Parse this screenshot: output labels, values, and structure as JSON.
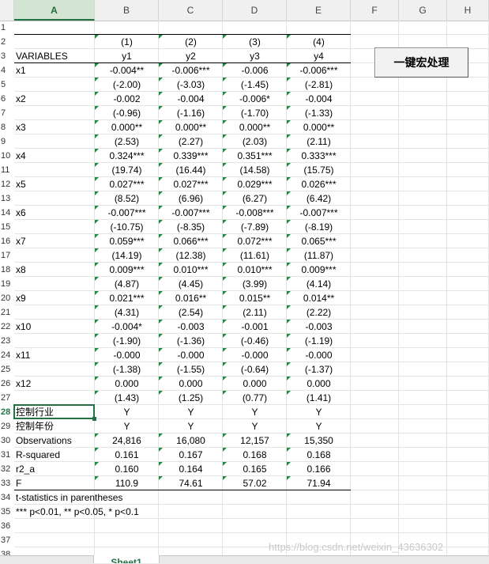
{
  "columns": [
    "A",
    "B",
    "C",
    "D",
    "E",
    "F",
    "G",
    "H"
  ],
  "rows": [
    "1",
    "2",
    "3",
    "4",
    "5",
    "6",
    "7",
    "8",
    "9",
    "10",
    "11",
    "12",
    "13",
    "14",
    "15",
    "16",
    "17",
    "18",
    "19",
    "20",
    "21",
    "22",
    "23",
    "24",
    "25",
    "26",
    "27",
    "28",
    "29",
    "30",
    "31",
    "32",
    "33",
    "34",
    "35",
    "36",
    "37",
    "38"
  ],
  "selected_column": "A",
  "selected_row": "28",
  "cells": [
    {
      "r": 2,
      "c": "B",
      "v": "(1)",
      "tri": true
    },
    {
      "r": 2,
      "c": "C",
      "v": "(2)",
      "tri": true
    },
    {
      "r": 2,
      "c": "D",
      "v": "(3)",
      "tri": true
    },
    {
      "r": 2,
      "c": "E",
      "v": "(4)",
      "tri": true
    },
    {
      "r": 3,
      "c": "A",
      "v": "VARIABLES"
    },
    {
      "r": 3,
      "c": "B",
      "v": "y1"
    },
    {
      "r": 3,
      "c": "C",
      "v": "y2"
    },
    {
      "r": 3,
      "c": "D",
      "v": "y3"
    },
    {
      "r": 3,
      "c": "E",
      "v": "y4"
    },
    {
      "r": 4,
      "c": "A",
      "v": "x1"
    },
    {
      "r": 4,
      "c": "B",
      "v": "-0.004**",
      "tri": true
    },
    {
      "r": 4,
      "c": "C",
      "v": "-0.006***",
      "tri": true
    },
    {
      "r": 4,
      "c": "D",
      "v": "-0.006",
      "tri": true
    },
    {
      "r": 4,
      "c": "E",
      "v": "-0.006***",
      "tri": true
    },
    {
      "r": 5,
      "c": "B",
      "v": "(-2.00)",
      "tri": true
    },
    {
      "r": 5,
      "c": "C",
      "v": "(-3.03)",
      "tri": true
    },
    {
      "r": 5,
      "c": "D",
      "v": "(-1.45)",
      "tri": true
    },
    {
      "r": 5,
      "c": "E",
      "v": "(-2.81)",
      "tri": true
    },
    {
      "r": 6,
      "c": "A",
      "v": "x2"
    },
    {
      "r": 6,
      "c": "B",
      "v": "-0.002",
      "tri": true
    },
    {
      "r": 6,
      "c": "C",
      "v": "-0.004",
      "tri": true
    },
    {
      "r": 6,
      "c": "D",
      "v": "-0.006*",
      "tri": true
    },
    {
      "r": 6,
      "c": "E",
      "v": "-0.004",
      "tri": true
    },
    {
      "r": 7,
      "c": "B",
      "v": "(-0.96)",
      "tri": true
    },
    {
      "r": 7,
      "c": "C",
      "v": "(-1.16)",
      "tri": true
    },
    {
      "r": 7,
      "c": "D",
      "v": "(-1.70)",
      "tri": true
    },
    {
      "r": 7,
      "c": "E",
      "v": "(-1.33)",
      "tri": true
    },
    {
      "r": 8,
      "c": "A",
      "v": "x3"
    },
    {
      "r": 8,
      "c": "B",
      "v": "0.000**",
      "tri": true
    },
    {
      "r": 8,
      "c": "C",
      "v": "0.000**",
      "tri": true
    },
    {
      "r": 8,
      "c": "D",
      "v": "0.000**",
      "tri": true
    },
    {
      "r": 8,
      "c": "E",
      "v": "0.000**",
      "tri": true
    },
    {
      "r": 9,
      "c": "B",
      "v": "(2.53)",
      "tri": true
    },
    {
      "r": 9,
      "c": "C",
      "v": "(2.27)",
      "tri": true
    },
    {
      "r": 9,
      "c": "D",
      "v": "(2.03)",
      "tri": true
    },
    {
      "r": 9,
      "c": "E",
      "v": "(2.11)",
      "tri": true
    },
    {
      "r": 10,
      "c": "A",
      "v": "x4"
    },
    {
      "r": 10,
      "c": "B",
      "v": "0.324***",
      "tri": true
    },
    {
      "r": 10,
      "c": "C",
      "v": "0.339***",
      "tri": true
    },
    {
      "r": 10,
      "c": "D",
      "v": "0.351***",
      "tri": true
    },
    {
      "r": 10,
      "c": "E",
      "v": "0.333***",
      "tri": true
    },
    {
      "r": 11,
      "c": "B",
      "v": "(19.74)",
      "tri": true
    },
    {
      "r": 11,
      "c": "C",
      "v": "(16.44)",
      "tri": true
    },
    {
      "r": 11,
      "c": "D",
      "v": "(14.58)",
      "tri": true
    },
    {
      "r": 11,
      "c": "E",
      "v": "(15.75)",
      "tri": true
    },
    {
      "r": 12,
      "c": "A",
      "v": "x5"
    },
    {
      "r": 12,
      "c": "B",
      "v": "0.027***",
      "tri": true
    },
    {
      "r": 12,
      "c": "C",
      "v": "0.027***",
      "tri": true
    },
    {
      "r": 12,
      "c": "D",
      "v": "0.029***",
      "tri": true
    },
    {
      "r": 12,
      "c": "E",
      "v": "0.026***",
      "tri": true
    },
    {
      "r": 13,
      "c": "B",
      "v": "(8.52)",
      "tri": true
    },
    {
      "r": 13,
      "c": "C",
      "v": "(6.96)",
      "tri": true
    },
    {
      "r": 13,
      "c": "D",
      "v": "(6.27)",
      "tri": true
    },
    {
      "r": 13,
      "c": "E",
      "v": "(6.42)",
      "tri": true
    },
    {
      "r": 14,
      "c": "A",
      "v": "x6"
    },
    {
      "r": 14,
      "c": "B",
      "v": "-0.007***",
      "tri": true
    },
    {
      "r": 14,
      "c": "C",
      "v": "-0.007***",
      "tri": true
    },
    {
      "r": 14,
      "c": "D",
      "v": "-0.008***",
      "tri": true
    },
    {
      "r": 14,
      "c": "E",
      "v": "-0.007***",
      "tri": true
    },
    {
      "r": 15,
      "c": "B",
      "v": "(-10.75)",
      "tri": true
    },
    {
      "r": 15,
      "c": "C",
      "v": "(-8.35)",
      "tri": true
    },
    {
      "r": 15,
      "c": "D",
      "v": "(-7.89)",
      "tri": true
    },
    {
      "r": 15,
      "c": "E",
      "v": "(-8.19)",
      "tri": true
    },
    {
      "r": 16,
      "c": "A",
      "v": "x7"
    },
    {
      "r": 16,
      "c": "B",
      "v": "0.059***",
      "tri": true
    },
    {
      "r": 16,
      "c": "C",
      "v": "0.066***",
      "tri": true
    },
    {
      "r": 16,
      "c": "D",
      "v": "0.072***",
      "tri": true
    },
    {
      "r": 16,
      "c": "E",
      "v": "0.065***",
      "tri": true
    },
    {
      "r": 17,
      "c": "B",
      "v": "(14.19)",
      "tri": true
    },
    {
      "r": 17,
      "c": "C",
      "v": "(12.38)",
      "tri": true
    },
    {
      "r": 17,
      "c": "D",
      "v": "(11.61)",
      "tri": true
    },
    {
      "r": 17,
      "c": "E",
      "v": "(11.87)",
      "tri": true
    },
    {
      "r": 18,
      "c": "A",
      "v": "x8"
    },
    {
      "r": 18,
      "c": "B",
      "v": "0.009***",
      "tri": true
    },
    {
      "r": 18,
      "c": "C",
      "v": "0.010***",
      "tri": true
    },
    {
      "r": 18,
      "c": "D",
      "v": "0.010***",
      "tri": true
    },
    {
      "r": 18,
      "c": "E",
      "v": "0.009***",
      "tri": true
    },
    {
      "r": 19,
      "c": "B",
      "v": "(4.87)",
      "tri": true
    },
    {
      "r": 19,
      "c": "C",
      "v": "(4.45)",
      "tri": true
    },
    {
      "r": 19,
      "c": "D",
      "v": "(3.99)",
      "tri": true
    },
    {
      "r": 19,
      "c": "E",
      "v": "(4.14)",
      "tri": true
    },
    {
      "r": 20,
      "c": "A",
      "v": "x9"
    },
    {
      "r": 20,
      "c": "B",
      "v": "0.021***",
      "tri": true
    },
    {
      "r": 20,
      "c": "C",
      "v": "0.016**",
      "tri": true
    },
    {
      "r": 20,
      "c": "D",
      "v": "0.015**",
      "tri": true
    },
    {
      "r": 20,
      "c": "E",
      "v": "0.014**",
      "tri": true
    },
    {
      "r": 21,
      "c": "B",
      "v": "(4.31)",
      "tri": true
    },
    {
      "r": 21,
      "c": "C",
      "v": "(2.54)",
      "tri": true
    },
    {
      "r": 21,
      "c": "D",
      "v": "(2.11)",
      "tri": true
    },
    {
      "r": 21,
      "c": "E",
      "v": "(2.22)",
      "tri": true
    },
    {
      "r": 22,
      "c": "A",
      "v": "x10"
    },
    {
      "r": 22,
      "c": "B",
      "v": "-0.004*",
      "tri": true
    },
    {
      "r": 22,
      "c": "C",
      "v": "-0.003",
      "tri": true
    },
    {
      "r": 22,
      "c": "D",
      "v": "-0.001",
      "tri": true
    },
    {
      "r": 22,
      "c": "E",
      "v": "-0.003",
      "tri": true
    },
    {
      "r": 23,
      "c": "B",
      "v": "(-1.90)",
      "tri": true
    },
    {
      "r": 23,
      "c": "C",
      "v": "(-1.36)",
      "tri": true
    },
    {
      "r": 23,
      "c": "D",
      "v": "(-0.46)",
      "tri": true
    },
    {
      "r": 23,
      "c": "E",
      "v": "(-1.19)",
      "tri": true
    },
    {
      "r": 24,
      "c": "A",
      "v": "x11"
    },
    {
      "r": 24,
      "c": "B",
      "v": "-0.000",
      "tri": true
    },
    {
      "r": 24,
      "c": "C",
      "v": "-0.000",
      "tri": true
    },
    {
      "r": 24,
      "c": "D",
      "v": "-0.000",
      "tri": true
    },
    {
      "r": 24,
      "c": "E",
      "v": "-0.000",
      "tri": true
    },
    {
      "r": 25,
      "c": "B",
      "v": "(-1.38)",
      "tri": true
    },
    {
      "r": 25,
      "c": "C",
      "v": "(-1.55)",
      "tri": true
    },
    {
      "r": 25,
      "c": "D",
      "v": "(-0.64)",
      "tri": true
    },
    {
      "r": 25,
      "c": "E",
      "v": "(-1.37)",
      "tri": true
    },
    {
      "r": 26,
      "c": "A",
      "v": "x12"
    },
    {
      "r": 26,
      "c": "B",
      "v": "0.000",
      "tri": true
    },
    {
      "r": 26,
      "c": "C",
      "v": "0.000",
      "tri": true
    },
    {
      "r": 26,
      "c": "D",
      "v": "0.000",
      "tri": true
    },
    {
      "r": 26,
      "c": "E",
      "v": "0.000",
      "tri": true
    },
    {
      "r": 27,
      "c": "B",
      "v": "(1.43)",
      "tri": true
    },
    {
      "r": 27,
      "c": "C",
      "v": "(1.25)",
      "tri": true
    },
    {
      "r": 27,
      "c": "D",
      "v": "(0.77)",
      "tri": true
    },
    {
      "r": 27,
      "c": "E",
      "v": "(1.41)",
      "tri": true
    },
    {
      "r": 28,
      "c": "A",
      "v": "控制行业"
    },
    {
      "r": 28,
      "c": "B",
      "v": "Y"
    },
    {
      "r": 28,
      "c": "C",
      "v": "Y"
    },
    {
      "r": 28,
      "c": "D",
      "v": "Y"
    },
    {
      "r": 28,
      "c": "E",
      "v": "Y"
    },
    {
      "r": 29,
      "c": "A",
      "v": "控制年份"
    },
    {
      "r": 29,
      "c": "B",
      "v": "Y"
    },
    {
      "r": 29,
      "c": "C",
      "v": "Y"
    },
    {
      "r": 29,
      "c": "D",
      "v": "Y"
    },
    {
      "r": 29,
      "c": "E",
      "v": "Y"
    },
    {
      "r": 30,
      "c": "A",
      "v": "Observations"
    },
    {
      "r": 30,
      "c": "B",
      "v": "24,816",
      "tri": true
    },
    {
      "r": 30,
      "c": "C",
      "v": "16,080",
      "tri": true
    },
    {
      "r": 30,
      "c": "D",
      "v": "12,157",
      "tri": true
    },
    {
      "r": 30,
      "c": "E",
      "v": "15,350",
      "tri": true
    },
    {
      "r": 31,
      "c": "A",
      "v": "R-squared"
    },
    {
      "r": 31,
      "c": "B",
      "v": "0.161",
      "tri": true
    },
    {
      "r": 31,
      "c": "C",
      "v": "0.167",
      "tri": true
    },
    {
      "r": 31,
      "c": "D",
      "v": "0.168",
      "tri": true
    },
    {
      "r": 31,
      "c": "E",
      "v": "0.168",
      "tri": true
    },
    {
      "r": 32,
      "c": "A",
      "v": "r2_a"
    },
    {
      "r": 32,
      "c": "B",
      "v": "0.160",
      "tri": true
    },
    {
      "r": 32,
      "c": "C",
      "v": "0.164",
      "tri": true
    },
    {
      "r": 32,
      "c": "D",
      "v": "0.165",
      "tri": true
    },
    {
      "r": 32,
      "c": "E",
      "v": "0.166",
      "tri": true
    },
    {
      "r": 33,
      "c": "A",
      "v": "F"
    },
    {
      "r": 33,
      "c": "B",
      "v": "110.9",
      "tri": true
    },
    {
      "r": 33,
      "c": "C",
      "v": "74.61",
      "tri": true
    },
    {
      "r": 33,
      "c": "D",
      "v": "57.02",
      "tri": true
    },
    {
      "r": 33,
      "c": "E",
      "v": "71.94",
      "tri": true
    },
    {
      "r": 34,
      "c": "A",
      "v": "t-statistics in parentheses"
    },
    {
      "r": 35,
      "c": "A",
      "v": "*** p<0.01, ** p<0.05, * p<0.1"
    }
  ],
  "macro_button": {
    "label": "一键宏处理"
  },
  "sheet_tab": {
    "label": "Sheet1"
  },
  "watermark": "https://blog.csdn.net/weixin_43636302"
}
